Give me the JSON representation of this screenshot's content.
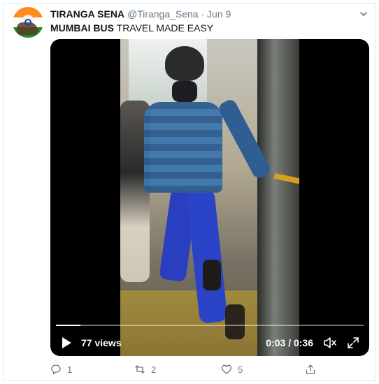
{
  "tweet": {
    "display_name": "TIRANGA SENA",
    "handle": "@Tiranga_Sena",
    "separator": "·",
    "date": "Jun 9",
    "text_bold": "MUMBAI BUS",
    "text_rest": " TRAVEL MADE EASY"
  },
  "video": {
    "views": "77 views",
    "time": "0:03 / 0:36",
    "progress_fraction": 0.08
  },
  "actions": {
    "replies": "1",
    "retweets": "2",
    "likes": "5"
  },
  "icons": {
    "menu": "chevron-down-icon",
    "play": "play-icon",
    "mute": "volume-muted-icon",
    "fullscreen": "fullscreen-icon",
    "reply": "reply-icon",
    "retweet": "retweet-icon",
    "like": "heart-icon",
    "share": "share-icon"
  },
  "colors": {
    "text": "#14171a",
    "secondary": "#657786",
    "border": "#e1e8ed"
  }
}
